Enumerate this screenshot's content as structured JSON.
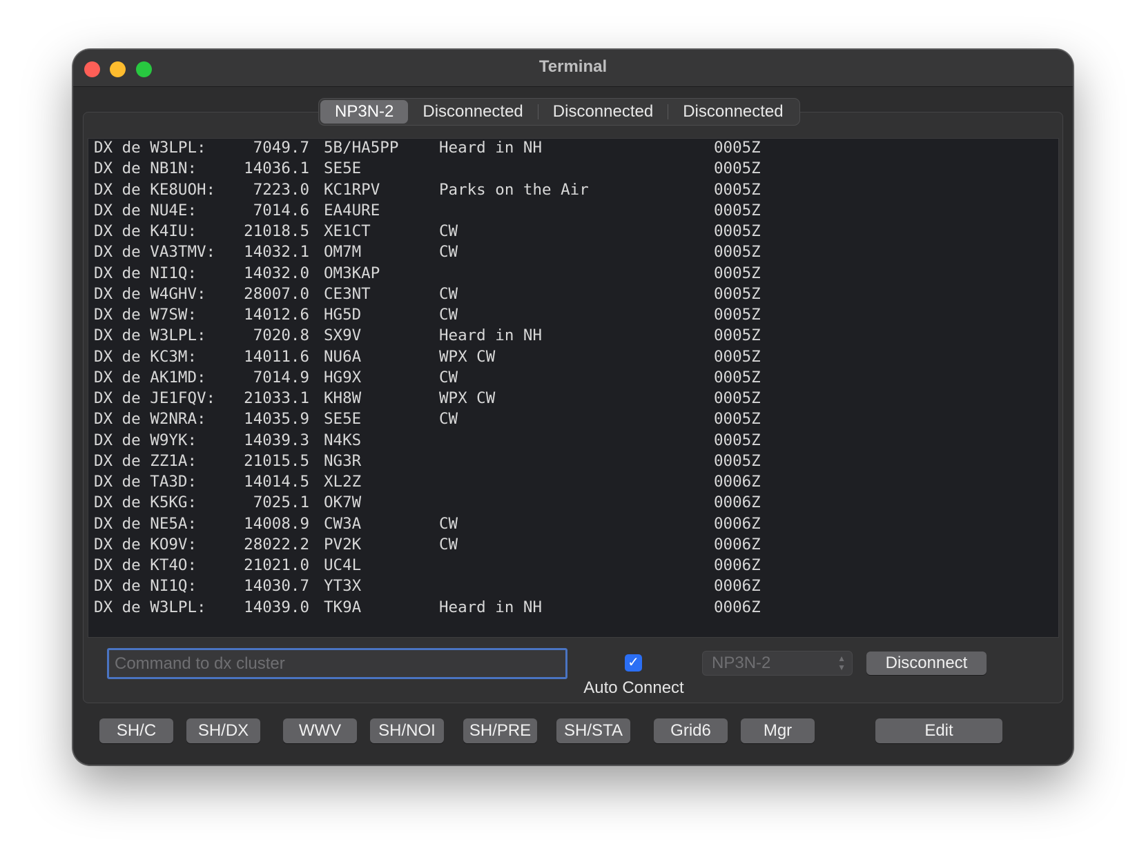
{
  "window": {
    "title": "Terminal"
  },
  "tabs": [
    "NP3N-2",
    "Disconnected",
    "Disconnected",
    "Disconnected"
  ],
  "spots": [
    {
      "dx": "DX de W3LPL:",
      "freq": "7049.7",
      "call": "5B/HA5PP",
      "comment": "Heard in NH",
      "time": "0005Z"
    },
    {
      "dx": "DX de NB1N:",
      "freq": "14036.1",
      "call": "SE5E",
      "comment": "",
      "time": "0005Z"
    },
    {
      "dx": "DX de KE8UOH:",
      "freq": "7223.0",
      "call": "KC1RPV",
      "comment": "Parks on the Air",
      "time": "0005Z"
    },
    {
      "dx": "DX de NU4E:",
      "freq": "7014.6",
      "call": "EA4URE",
      "comment": "",
      "time": "0005Z"
    },
    {
      "dx": "DX de K4IU:",
      "freq": "21018.5",
      "call": "XE1CT",
      "comment": "CW",
      "time": "0005Z"
    },
    {
      "dx": "DX de VA3TMV:",
      "freq": "14032.1",
      "call": "OM7M",
      "comment": "CW",
      "time": "0005Z"
    },
    {
      "dx": "DX de NI1Q:",
      "freq": "14032.0",
      "call": "OM3KAP",
      "comment": "",
      "time": "0005Z"
    },
    {
      "dx": "DX de W4GHV:",
      "freq": "28007.0",
      "call": "CE3NT",
      "comment": "CW",
      "time": "0005Z"
    },
    {
      "dx": "DX de W7SW:",
      "freq": "14012.6",
      "call": "HG5D",
      "comment": "CW",
      "time": "0005Z"
    },
    {
      "dx": "DX de W3LPL:",
      "freq": "7020.8",
      "call": "SX9V",
      "comment": "Heard in NH",
      "time": "0005Z"
    },
    {
      "dx": "DX de KC3M:",
      "freq": "14011.6",
      "call": "NU6A",
      "comment": "WPX CW",
      "time": "0005Z"
    },
    {
      "dx": "DX de AK1MD:",
      "freq": "7014.9",
      "call": "HG9X",
      "comment": "CW",
      "time": "0005Z"
    },
    {
      "dx": "DX de JE1FQV:",
      "freq": "21033.1",
      "call": "KH8W",
      "comment": "WPX CW",
      "time": "0005Z"
    },
    {
      "dx": "DX de W2NRA:",
      "freq": "14035.9",
      "call": "SE5E",
      "comment": "CW",
      "time": "0005Z"
    },
    {
      "dx": "DX de W9YK:",
      "freq": "14039.3",
      "call": "N4KS",
      "comment": "",
      "time": "0005Z"
    },
    {
      "dx": "DX de ZZ1A:",
      "freq": "21015.5",
      "call": "NG3R",
      "comment": "",
      "time": "0005Z"
    },
    {
      "dx": "DX de TA3D:",
      "freq": "14014.5",
      "call": "XL2Z",
      "comment": "",
      "time": "0006Z"
    },
    {
      "dx": "DX de K5KG:",
      "freq": "7025.1",
      "call": "OK7W",
      "comment": "",
      "time": "0006Z"
    },
    {
      "dx": "DX de NE5A:",
      "freq": "14008.9",
      "call": "CW3A",
      "comment": "CW",
      "time": "0006Z"
    },
    {
      "dx": "DX de KO9V:",
      "freq": "28022.2",
      "call": "PV2K",
      "comment": "CW",
      "time": "0006Z"
    },
    {
      "dx": "DX de KT4O:",
      "freq": "21021.0",
      "call": "UC4L",
      "comment": "",
      "time": "0006Z"
    },
    {
      "dx": "DX de NI1Q:",
      "freq": "14030.7",
      "call": "YT3X",
      "comment": "",
      "time": "0006Z"
    },
    {
      "dx": "DX de W3LPL:",
      "freq": "14039.0",
      "call": "TK9A",
      "comment": "Heard in NH",
      "time": "0006Z"
    }
  ],
  "command": {
    "placeholder": "Command to dx cluster",
    "value": ""
  },
  "auto_connect": {
    "label": "Auto Connect",
    "checked": true
  },
  "cluster_select": {
    "value": "NP3N-2"
  },
  "disconnect_label": "Disconnect",
  "macros": [
    {
      "label": "SH/C",
      "name": "sh-c"
    },
    {
      "label": "SH/DX",
      "name": "sh-dx"
    },
    {
      "label": "WWV",
      "name": "wwv"
    },
    {
      "label": "SH/NOI",
      "name": "sh-noi"
    },
    {
      "label": "SH/PRE",
      "name": "sh-pre"
    },
    {
      "label": "SH/STA",
      "name": "sh-sta"
    },
    {
      "label": "Grid6",
      "name": "grid6"
    },
    {
      "label": "Mgr",
      "name": "mgr"
    }
  ],
  "edit_label": "Edit",
  "colors": {
    "window_bg": "#2d2d2e",
    "terminal_bg": "#1e1f23",
    "accent": "#2b6ff5",
    "focus_ring": "#4a74c2"
  }
}
